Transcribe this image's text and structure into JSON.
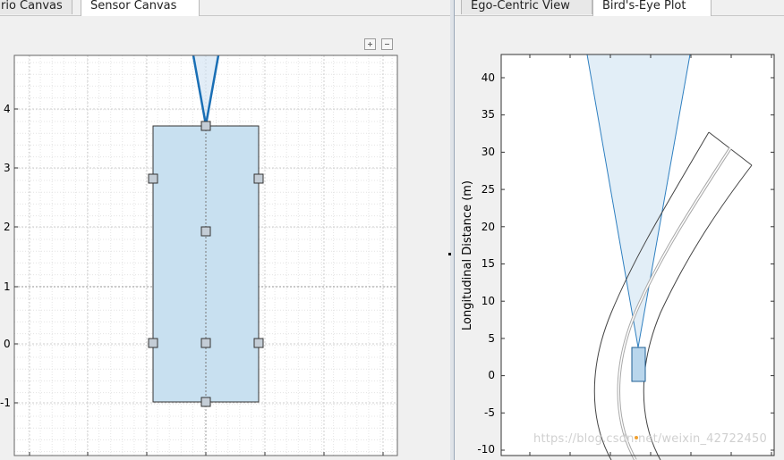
{
  "left_pane": {
    "tabs": [
      {
        "label": "rio Canvas",
        "active": false
      },
      {
        "label": "Sensor Canvas",
        "active": true
      }
    ],
    "zoom_in_icon": "plus-icon",
    "zoom_out_icon": "minus-icon",
    "canvas": {
      "y_ticks": [
        "4",
        "3",
        "2",
        "1",
        "0",
        "-1"
      ],
      "vehicle_fill": "#c8e0f0",
      "sensor_color": "#1a6fb5"
    }
  },
  "right_pane": {
    "tabs": [
      {
        "label": "Ego-Centric View",
        "active": false
      },
      {
        "label": "Bird's-Eye Plot",
        "active": true
      }
    ],
    "plot": {
      "ylabel": "Longitudinal Distance (m)",
      "y_ticks": [
        "40",
        "35",
        "30",
        "25",
        "20",
        "15",
        "10",
        "5",
        "0",
        "-5",
        "-10"
      ],
      "coverage_fill": "#e2eef7",
      "coverage_stroke": "#2e7fc0"
    }
  },
  "watermark": "https://blog.csdn.net/weixin_42722450"
}
